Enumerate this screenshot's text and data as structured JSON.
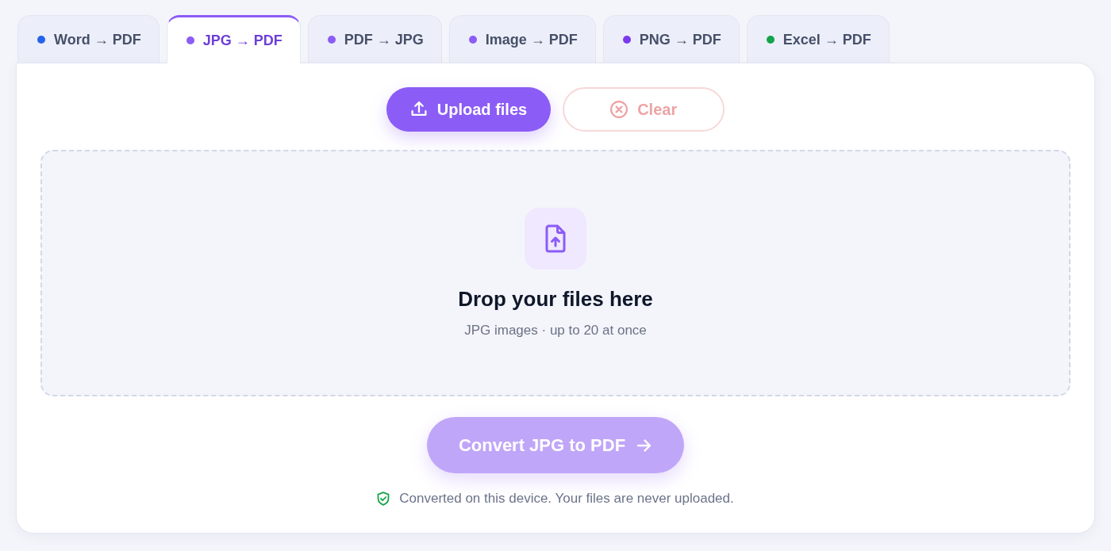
{
  "tabs": [
    {
      "label": "Word → PDF",
      "color": "#2563eb",
      "selected": false
    },
    {
      "label": "JPG → PDF",
      "color": "#8b5cf6",
      "selected": true
    },
    {
      "label": "PDF → JPG",
      "color": "#8b5cf6",
      "selected": false
    },
    {
      "label": "Image → PDF",
      "color": "#8b5cf6",
      "selected": false
    },
    {
      "label": "PNG → PDF",
      "color": "#7c3aed",
      "selected": false
    },
    {
      "label": "Excel → PDF",
      "color": "#16a34a",
      "selected": false
    }
  ],
  "actions": [
    {
      "label": "Upload files",
      "kind": "upload",
      "disabled": false
    },
    {
      "label": "Clear",
      "kind": "clear",
      "disabled": true
    }
  ],
  "dropzone": {
    "title": "Drop your files here",
    "hint": "JPG images · up to 20 at once"
  },
  "convert": {
    "label": "Convert JPG to PDF",
    "disabled": true
  },
  "note": "Converted on this device. Your files are never uploaded."
}
